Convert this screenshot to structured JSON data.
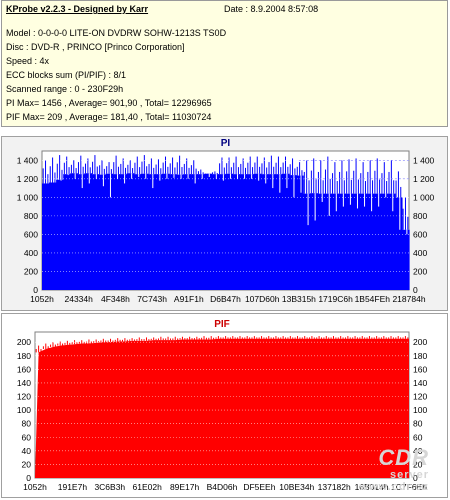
{
  "info": {
    "title": "KProbe v2.2.3 - Designed by Karr",
    "date": "Date : 8.9.2004 8:57:08",
    "lines": [
      "Model : 0-0-0-0 LITE-ON DVDRW SOHW-1213S TS0D",
      "Disc : DVD-R , PRINCO [Princo Corporation]",
      "Speed : 4x",
      "ECC blocks sum (PI/PIF) : 8/1",
      "Scanned range : 0 - 230F29h",
      "PI Max= 1456 , Average= 901,90 , Total= 12296965",
      "PIF Max= 209 , Average= 181,40 , Total= 11030724"
    ]
  },
  "watermark": {
    "logo": "CDR",
    "sub": "server",
    "url": "www.cdr.cz"
  },
  "colors": {
    "pi": "#0000ff",
    "pif": "#ff0000",
    "plot_bg": "#ffffff",
    "panel_bg": "#f2f2f2"
  },
  "chart_data": [
    {
      "type": "bar",
      "title": "PI",
      "ylim": [
        0,
        1500
      ],
      "yticks": [
        0,
        200,
        400,
        600,
        800,
        1000,
        1200,
        1400
      ],
      "ytick_labels": [
        "0",
        "200",
        "400",
        "600",
        "800",
        "1 000",
        "1 200",
        "1 400"
      ],
      "xtick_labels": [
        "1052h",
        "24334h",
        "4F348h",
        "7C743h",
        "A91F1h",
        "D6B47h",
        "107D60h",
        "13B315h",
        "1719C6h",
        "1B54FEh",
        "218784h"
      ],
      "grid": true,
      "series": [
        {
          "values": [
            1150,
            1160,
            1190,
            1250,
            1260,
            1250,
            1260,
            1250,
            1245,
            1255,
            1250,
            1250,
            1260,
            1250,
            1255,
            1250,
            1250,
            1255,
            1250,
            1245,
            1250,
            1250,
            1250,
            1255,
            1250,
            1250,
            1255,
            1250,
            1250,
            1250,
            1255,
            1250,
            1250,
            1250,
            1255,
            1240,
            1235,
            1040,
            1045,
            1040,
            1040,
            1040,
            1040,
            1040,
            1040,
            1040,
            1040,
            1040,
            1040,
            1040,
            1000,
            650
          ],
          "peaks": [
            1400,
            1430,
            1456,
            1440,
            1400,
            1450,
            1420,
            1456,
            1400,
            1380,
            1450,
            1420,
            1400,
            1440,
            1456,
            1420,
            1410,
            1440,
            1430,
            1450,
            1420,
            1400,
            1300,
            1250,
            1280,
            1430,
            1430,
            1440,
            1420,
            1440,
            1440,
            1430,
            1450,
            1440,
            1440,
            1420,
            1380,
            1400,
            1420,
            1400,
            1440,
            1380,
            1400,
            1410,
            1420,
            1380,
            1400,
            1420,
            1380,
            1400,
            1280,
            1000
          ],
          "dips": [
            1150,
            1160,
            1180,
            1240,
            1200,
            1100,
            1150,
            1200,
            1120,
            1000,
            1200,
            1150,
            1200,
            1220,
            1200,
            1100,
            1180,
            1200,
            1210,
            1200,
            1200,
            1150,
            1200,
            1220,
            1200,
            1180,
            1200,
            1200,
            1200,
            1200,
            1180,
            1150,
            1100,
            1050,
            1100,
            1000,
            1050,
            700,
            750,
            950,
            800,
            850,
            900,
            920,
            880,
            900,
            850,
            900,
            1000,
            850,
            650,
            600
          ]
        }
      ]
    },
    {
      "type": "area",
      "title": "PIF",
      "ylim": [
        0,
        215
      ],
      "yticks": [
        0,
        20,
        40,
        60,
        80,
        100,
        120,
        140,
        160,
        180,
        200
      ],
      "ytick_labels": [
        "0",
        "20",
        "40",
        "60",
        "80",
        "100",
        "120",
        "140",
        "160",
        "180",
        "200"
      ],
      "xtick_labels": [
        "1052h",
        "191E7h",
        "3C6B3h",
        "61E02h",
        "89E17h",
        "B4D06h",
        "DF5EEh",
        "10BE34h",
        "137182h",
        "16B014h",
        "1C7F6Eh"
      ],
      "grid": true,
      "series": [
        {
          "values": [
            185,
            190,
            193,
            195,
            196,
            197,
            198,
            198,
            199,
            200,
            200,
            201,
            201,
            202,
            202,
            202,
            203,
            203,
            203,
            203,
            204,
            204,
            204,
            204,
            204,
            205,
            205,
            205,
            205,
            205,
            205,
            205,
            205,
            205,
            205,
            205,
            205,
            205,
            205,
            205,
            205,
            205,
            205,
            205,
            205,
            205,
            205,
            205,
            205,
            205,
            205,
            205
          ],
          "peaks": [
            195,
            198,
            200,
            201,
            202,
            203,
            203,
            204,
            204,
            205,
            205,
            206,
            206,
            206,
            207,
            207,
            207,
            208,
            208,
            208,
            208,
            208,
            208,
            209,
            209,
            209,
            209,
            209,
            209,
            209,
            209,
            209,
            209,
            209,
            209,
            209,
            209,
            209,
            209,
            209,
            209,
            209,
            209,
            209,
            209,
            209,
            209,
            209,
            209,
            209,
            209,
            209
          ]
        }
      ]
    }
  ]
}
